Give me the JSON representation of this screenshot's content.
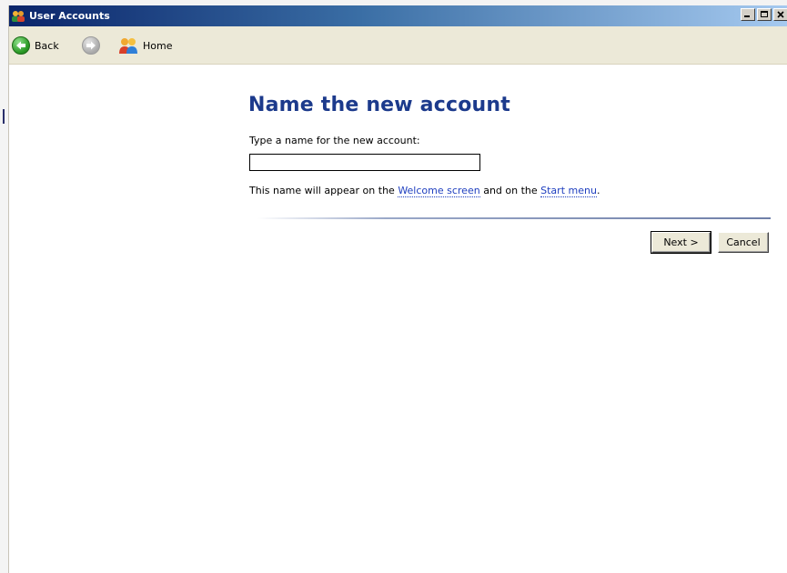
{
  "window": {
    "title": "User Accounts"
  },
  "toolbar": {
    "back_label": "Back",
    "home_label": "Home"
  },
  "main": {
    "heading": "Name the new account",
    "prompt": "Type a name for the new account:",
    "name_value": "",
    "info_prefix": "This name will appear on the ",
    "info_link1": "Welcome screen",
    "info_middle": " and on the ",
    "info_link2": "Start menu",
    "info_suffix": "."
  },
  "buttons": {
    "next_label": "Next >",
    "cancel_label": "Cancel"
  },
  "icons": {
    "title": "user-accounts-icon",
    "back": "back-arrow-icon",
    "forward": "forward-arrow-icon",
    "home": "home-users-icon"
  },
  "colors": {
    "heading": "#1c3a8c",
    "link": "#1f3fbf",
    "titlebar_start": "#0a246a",
    "titlebar_end": "#a6caf0",
    "back_green": "#2b9a26"
  }
}
